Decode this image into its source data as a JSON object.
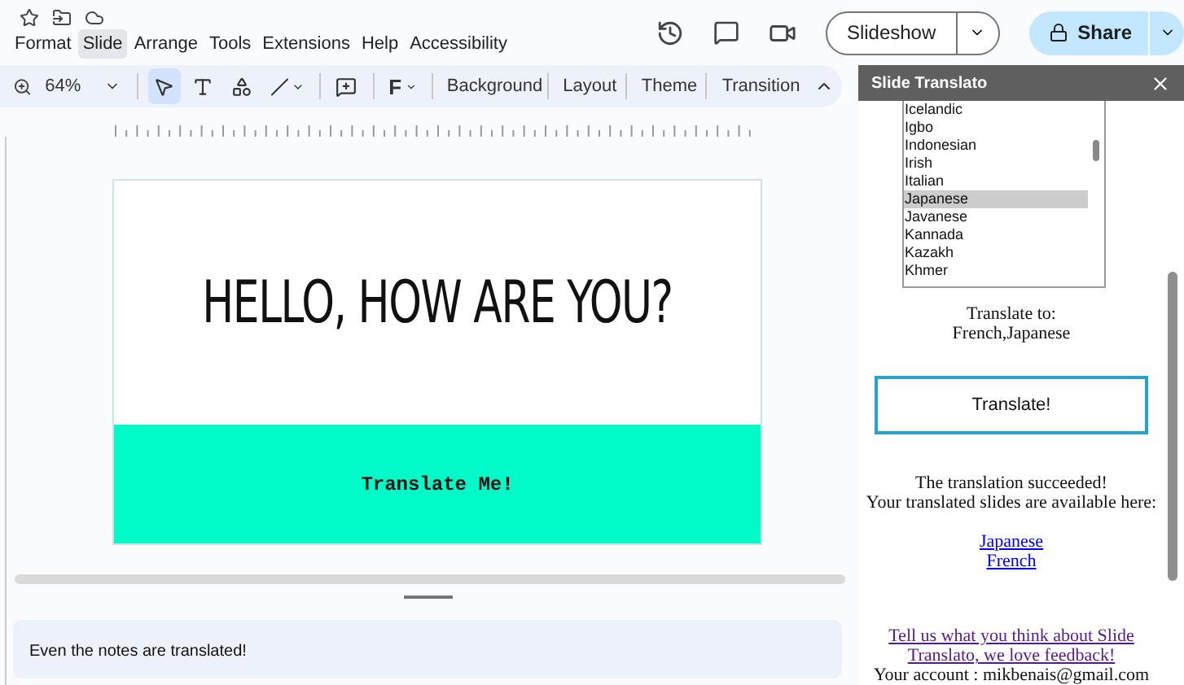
{
  "menu": [
    {
      "label": "Format",
      "selected": false
    },
    {
      "label": "Slide",
      "selected": true
    },
    {
      "label": "Arrange",
      "selected": false
    },
    {
      "label": "Tools",
      "selected": false
    },
    {
      "label": "Extensions",
      "selected": false
    },
    {
      "label": "Help",
      "selected": false
    },
    {
      "label": "Accessibility",
      "selected": false
    }
  ],
  "header_buttons": {
    "slideshow": "Slideshow",
    "share": "Share"
  },
  "toolbar": {
    "zoom": "64%",
    "font_icon": "F",
    "buttons": [
      "Background",
      "Layout",
      "Theme",
      "Transition"
    ]
  },
  "slide": {
    "title": "HELLO, HOW ARE YOU?",
    "banner_text": "Translate Me!"
  },
  "notes": "Even the notes are translated!",
  "panel": {
    "title": "Slide Translato",
    "languages": [
      {
        "label": "Icelandic",
        "selected": false
      },
      {
        "label": "Igbo",
        "selected": false
      },
      {
        "label": "Indonesian",
        "selected": false
      },
      {
        "label": "Irish",
        "selected": false
      },
      {
        "label": "Italian",
        "selected": false
      },
      {
        "label": "Japanese",
        "selected": true
      },
      {
        "label": "Javanese",
        "selected": false
      },
      {
        "label": "Kannada",
        "selected": false
      },
      {
        "label": "Kazakh",
        "selected": false
      },
      {
        "label": "Khmer",
        "selected": false
      }
    ],
    "translate_to_label": "Translate to:",
    "translate_to_value": "French,Japanese",
    "translate_button": "Translate!",
    "success": "The translation succeeded!",
    "available": "Your translated slides are available here:",
    "links": [
      "Japanese",
      "French"
    ],
    "feedback": "Tell us what you think about Slide Translato, we love feedback!",
    "account": "Your account : mikbenais@gmail.com"
  }
}
